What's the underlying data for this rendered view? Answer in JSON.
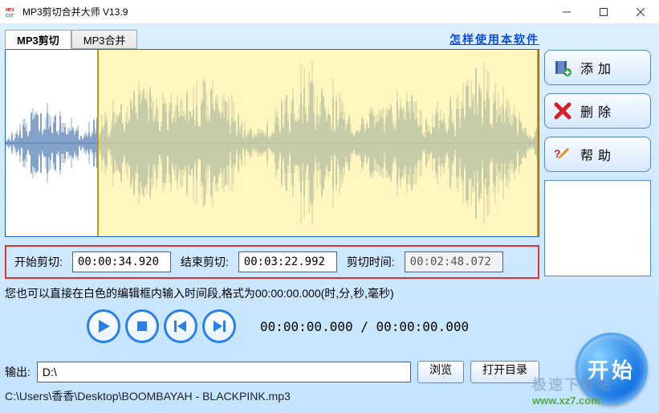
{
  "window": {
    "title": "MP3剪切合并大师 V13.9"
  },
  "tabs": {
    "cut": "MP3剪切",
    "merge": "MP3合并"
  },
  "help_link": "怎样使用本软件",
  "selection": {
    "start_pct": 17.2,
    "end_pct": 100
  },
  "time": {
    "start_label": "开始剪切:",
    "start_value": "00:00:34.920",
    "end_label": "结束剪切:",
    "end_value": "00:03:22.992",
    "dur_label": "剪切时间:",
    "dur_value": "00:02:48.072"
  },
  "hint": "您也可以直接在白色的编辑框内输入时间段,格式为00:00:00.000(时,分,秒,毫秒)",
  "position": {
    "current": "00:00:00.000",
    "total": "00:00:00.000",
    "sep": " / "
  },
  "output": {
    "label": "输出:",
    "path": "D:\\",
    "browse": "浏览",
    "open_dir": "打开目录"
  },
  "file_path": "C:\\Users\\香香\\Desktop\\BOOMBAYAH - BLACKPINK.mp3",
  "side": {
    "add": "添加",
    "delete": "删除",
    "help": "帮助"
  },
  "start_button": "开始",
  "watermark": {
    "line1": "极速下载站",
    "line2": "www.xz7.com"
  }
}
